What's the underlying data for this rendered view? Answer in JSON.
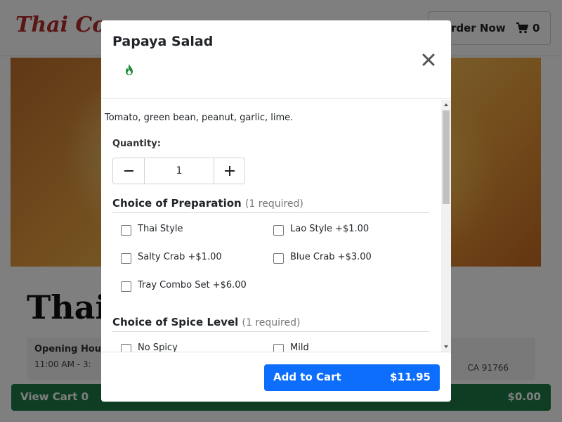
{
  "background_page": {
    "brand_name": "Thai Corn",
    "order_button_label": "rder Now",
    "cart_count": "0",
    "restaurant_name": "Thai",
    "info": {
      "title": "Opening Hou",
      "hours": "11:00 AM - 3:",
      "address_fragment": "CA 91766"
    },
    "view_cart": {
      "label": "View Cart 0",
      "total": "$0.00"
    }
  },
  "modal": {
    "title": "Papaya Salad",
    "spice_indicator_icon": "flame-icon",
    "description": "Tomato, green bean, peanut, garlic, lime.",
    "quantity": {
      "label": "Quantity:",
      "value": "1"
    },
    "sections": [
      {
        "title": "Choice of Preparation",
        "requirement": "(1 required)",
        "options": [
          {
            "label": "Thai Style",
            "checked": false
          },
          {
            "label": "Lao Style +$1.00",
            "checked": false
          },
          {
            "label": "Salty Crab +$1.00",
            "checked": false
          },
          {
            "label": "Blue Crab +$3.00",
            "checked": false
          },
          {
            "label": "Tray Combo Set +$6.00",
            "checked": false
          }
        ]
      },
      {
        "title": "Choice of Spice Level",
        "requirement": "(1 required)",
        "options": [
          {
            "label": "No Spicy",
            "checked": false
          },
          {
            "label": "Mild",
            "checked": false
          }
        ]
      }
    ],
    "footer": {
      "add_label": "Add to Cart",
      "price": "$11.95"
    }
  },
  "colors": {
    "brand": "#b52a2a",
    "primary_button": "#0d6efd",
    "view_cart_bar": "#1e7a46",
    "spice_icon": "#1f8a3c"
  }
}
